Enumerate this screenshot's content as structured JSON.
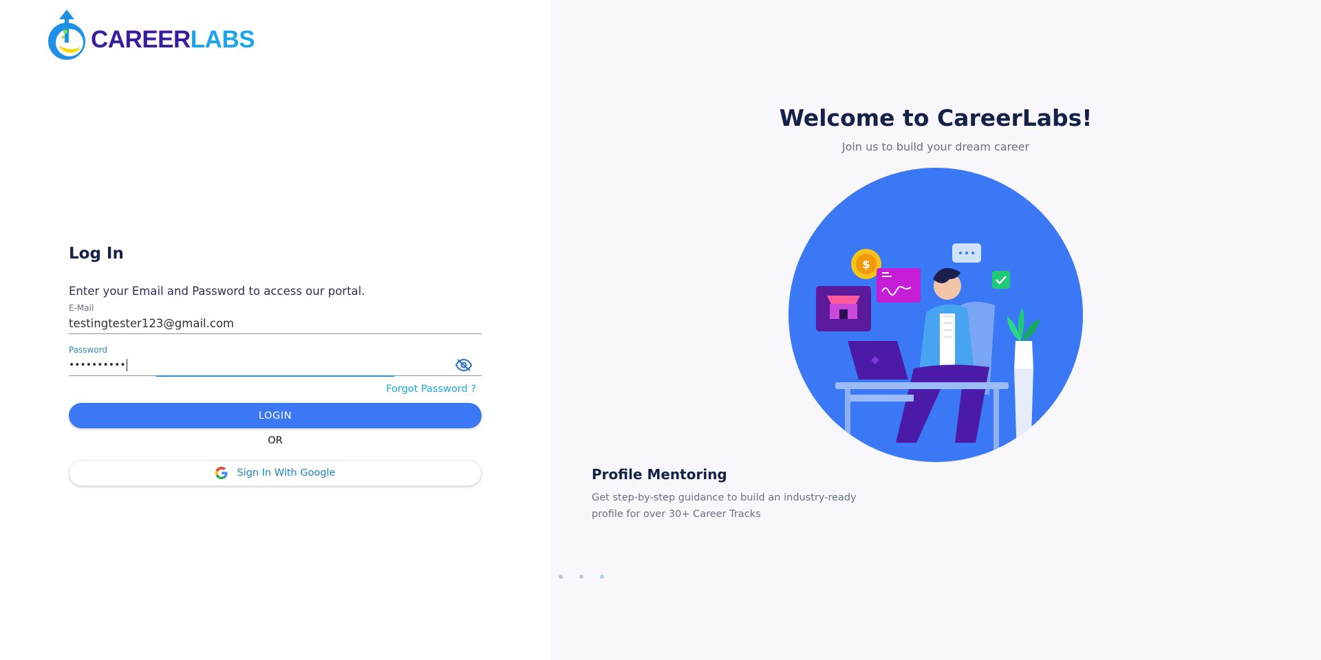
{
  "logo": {
    "text_career": "CAREER",
    "text_labs": "LABS"
  },
  "login": {
    "title": "Log In",
    "subtitle": "Enter your Email and Password to access our portal.",
    "email_label": "E-Mail",
    "email_value": "testingtester123@gmail.com",
    "password_label": "Password",
    "password_value": "••••••••••",
    "forgot_label": "Forgot Password ?",
    "login_button": "LOGIN",
    "or_text": "OR",
    "google_button": "Sign In With Google"
  },
  "welcome": {
    "title": "Welcome to CareerLabs!",
    "subtitle": "Join us to build your dream career"
  },
  "carousel": {
    "feature_title": "Profile Mentoring",
    "feature_desc": "Get step-by-step guidance to build an industry-ready profile for over 30+ Career Tracks",
    "slide_count": 3,
    "active_slide": 3
  },
  "colors": {
    "primary": "#3b78f5",
    "heading": "#16214a",
    "link": "#1ba6d8",
    "brand_purple": "#3a1d9e",
    "brand_blue": "#1ea4ef",
    "right_bg": "#f8f8fc"
  },
  "icons": {
    "logo": "careerlabs-logo-icon",
    "eye_toggle": "eye-off-icon",
    "google": "google-icon"
  }
}
